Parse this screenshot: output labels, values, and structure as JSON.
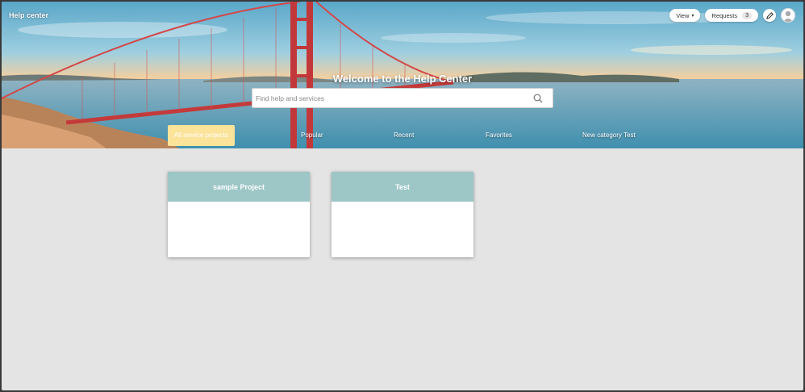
{
  "header": {
    "brand": "Help center",
    "view_label": "View",
    "requests_label": "Requests",
    "requests_count": "3",
    "edit_icon": "pencil-icon",
    "avatar_icon": "user-avatar-icon"
  },
  "hero": {
    "welcome": "Welcome to the Help Center",
    "background": "golden-gate-bridge-photo"
  },
  "search": {
    "placeholder": "Find help and services",
    "icon": "search-icon"
  },
  "tabs": [
    {
      "label": "All service projects",
      "active": true
    },
    {
      "label": "Popular",
      "active": false
    },
    {
      "label": "Recent",
      "active": false
    },
    {
      "label": "Favorites",
      "active": false
    },
    {
      "label": "New category Test",
      "active": false
    }
  ],
  "projects": [
    {
      "title": "sample Project"
    },
    {
      "title": "Test"
    }
  ],
  "colors": {
    "card_header": "#9dc6c6",
    "active_tab": "#fbe39a",
    "page_background": "#e4e4e4"
  }
}
